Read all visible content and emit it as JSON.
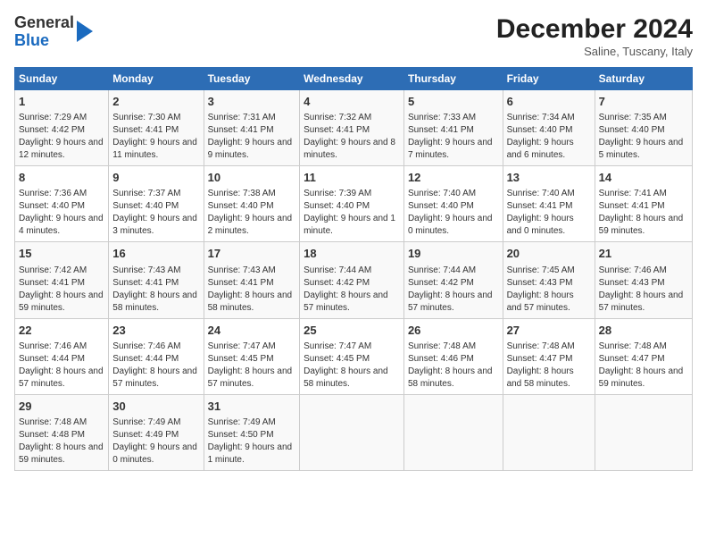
{
  "logo": {
    "line1": "General",
    "line2": "Blue"
  },
  "header": {
    "title": "December 2024",
    "subtitle": "Saline, Tuscany, Italy"
  },
  "weekdays": [
    "Sunday",
    "Monday",
    "Tuesday",
    "Wednesday",
    "Thursday",
    "Friday",
    "Saturday"
  ],
  "weeks": [
    [
      {
        "day": "1",
        "sunrise": "Sunrise: 7:29 AM",
        "sunset": "Sunset: 4:42 PM",
        "daylight": "Daylight: 9 hours and 12 minutes."
      },
      {
        "day": "2",
        "sunrise": "Sunrise: 7:30 AM",
        "sunset": "Sunset: 4:41 PM",
        "daylight": "Daylight: 9 hours and 11 minutes."
      },
      {
        "day": "3",
        "sunrise": "Sunrise: 7:31 AM",
        "sunset": "Sunset: 4:41 PM",
        "daylight": "Daylight: 9 hours and 9 minutes."
      },
      {
        "day": "4",
        "sunrise": "Sunrise: 7:32 AM",
        "sunset": "Sunset: 4:41 PM",
        "daylight": "Daylight: 9 hours and 8 minutes."
      },
      {
        "day": "5",
        "sunrise": "Sunrise: 7:33 AM",
        "sunset": "Sunset: 4:41 PM",
        "daylight": "Daylight: 9 hours and 7 minutes."
      },
      {
        "day": "6",
        "sunrise": "Sunrise: 7:34 AM",
        "sunset": "Sunset: 4:40 PM",
        "daylight": "Daylight: 9 hours and 6 minutes."
      },
      {
        "day": "7",
        "sunrise": "Sunrise: 7:35 AM",
        "sunset": "Sunset: 4:40 PM",
        "daylight": "Daylight: 9 hours and 5 minutes."
      }
    ],
    [
      {
        "day": "8",
        "sunrise": "Sunrise: 7:36 AM",
        "sunset": "Sunset: 4:40 PM",
        "daylight": "Daylight: 9 hours and 4 minutes."
      },
      {
        "day": "9",
        "sunrise": "Sunrise: 7:37 AM",
        "sunset": "Sunset: 4:40 PM",
        "daylight": "Daylight: 9 hours and 3 minutes."
      },
      {
        "day": "10",
        "sunrise": "Sunrise: 7:38 AM",
        "sunset": "Sunset: 4:40 PM",
        "daylight": "Daylight: 9 hours and 2 minutes."
      },
      {
        "day": "11",
        "sunrise": "Sunrise: 7:39 AM",
        "sunset": "Sunset: 4:40 PM",
        "daylight": "Daylight: 9 hours and 1 minute."
      },
      {
        "day": "12",
        "sunrise": "Sunrise: 7:40 AM",
        "sunset": "Sunset: 4:40 PM",
        "daylight": "Daylight: 9 hours and 0 minutes."
      },
      {
        "day": "13",
        "sunrise": "Sunrise: 7:40 AM",
        "sunset": "Sunset: 4:41 PM",
        "daylight": "Daylight: 9 hours and 0 minutes."
      },
      {
        "day": "14",
        "sunrise": "Sunrise: 7:41 AM",
        "sunset": "Sunset: 4:41 PM",
        "daylight": "Daylight: 8 hours and 59 minutes."
      }
    ],
    [
      {
        "day": "15",
        "sunrise": "Sunrise: 7:42 AM",
        "sunset": "Sunset: 4:41 PM",
        "daylight": "Daylight: 8 hours and 59 minutes."
      },
      {
        "day": "16",
        "sunrise": "Sunrise: 7:43 AM",
        "sunset": "Sunset: 4:41 PM",
        "daylight": "Daylight: 8 hours and 58 minutes."
      },
      {
        "day": "17",
        "sunrise": "Sunrise: 7:43 AM",
        "sunset": "Sunset: 4:41 PM",
        "daylight": "Daylight: 8 hours and 58 minutes."
      },
      {
        "day": "18",
        "sunrise": "Sunrise: 7:44 AM",
        "sunset": "Sunset: 4:42 PM",
        "daylight": "Daylight: 8 hours and 57 minutes."
      },
      {
        "day": "19",
        "sunrise": "Sunrise: 7:44 AM",
        "sunset": "Sunset: 4:42 PM",
        "daylight": "Daylight: 8 hours and 57 minutes."
      },
      {
        "day": "20",
        "sunrise": "Sunrise: 7:45 AM",
        "sunset": "Sunset: 4:43 PM",
        "daylight": "Daylight: 8 hours and 57 minutes."
      },
      {
        "day": "21",
        "sunrise": "Sunrise: 7:46 AM",
        "sunset": "Sunset: 4:43 PM",
        "daylight": "Daylight: 8 hours and 57 minutes."
      }
    ],
    [
      {
        "day": "22",
        "sunrise": "Sunrise: 7:46 AM",
        "sunset": "Sunset: 4:44 PM",
        "daylight": "Daylight: 8 hours and 57 minutes."
      },
      {
        "day": "23",
        "sunrise": "Sunrise: 7:46 AM",
        "sunset": "Sunset: 4:44 PM",
        "daylight": "Daylight: 8 hours and 57 minutes."
      },
      {
        "day": "24",
        "sunrise": "Sunrise: 7:47 AM",
        "sunset": "Sunset: 4:45 PM",
        "daylight": "Daylight: 8 hours and 57 minutes."
      },
      {
        "day": "25",
        "sunrise": "Sunrise: 7:47 AM",
        "sunset": "Sunset: 4:45 PM",
        "daylight": "Daylight: 8 hours and 58 minutes."
      },
      {
        "day": "26",
        "sunrise": "Sunrise: 7:48 AM",
        "sunset": "Sunset: 4:46 PM",
        "daylight": "Daylight: 8 hours and 58 minutes."
      },
      {
        "day": "27",
        "sunrise": "Sunrise: 7:48 AM",
        "sunset": "Sunset: 4:47 PM",
        "daylight": "Daylight: 8 hours and 58 minutes."
      },
      {
        "day": "28",
        "sunrise": "Sunrise: 7:48 AM",
        "sunset": "Sunset: 4:47 PM",
        "daylight": "Daylight: 8 hours and 59 minutes."
      }
    ],
    [
      {
        "day": "29",
        "sunrise": "Sunrise: 7:48 AM",
        "sunset": "Sunset: 4:48 PM",
        "daylight": "Daylight: 8 hours and 59 minutes."
      },
      {
        "day": "30",
        "sunrise": "Sunrise: 7:49 AM",
        "sunset": "Sunset: 4:49 PM",
        "daylight": "Daylight: 9 hours and 0 minutes."
      },
      {
        "day": "31",
        "sunrise": "Sunrise: 7:49 AM",
        "sunset": "Sunset: 4:50 PM",
        "daylight": "Daylight: 9 hours and 1 minute."
      },
      {
        "day": "",
        "sunrise": "",
        "sunset": "",
        "daylight": ""
      },
      {
        "day": "",
        "sunrise": "",
        "sunset": "",
        "daylight": ""
      },
      {
        "day": "",
        "sunrise": "",
        "sunset": "",
        "daylight": ""
      },
      {
        "day": "",
        "sunrise": "",
        "sunset": "",
        "daylight": ""
      }
    ]
  ]
}
